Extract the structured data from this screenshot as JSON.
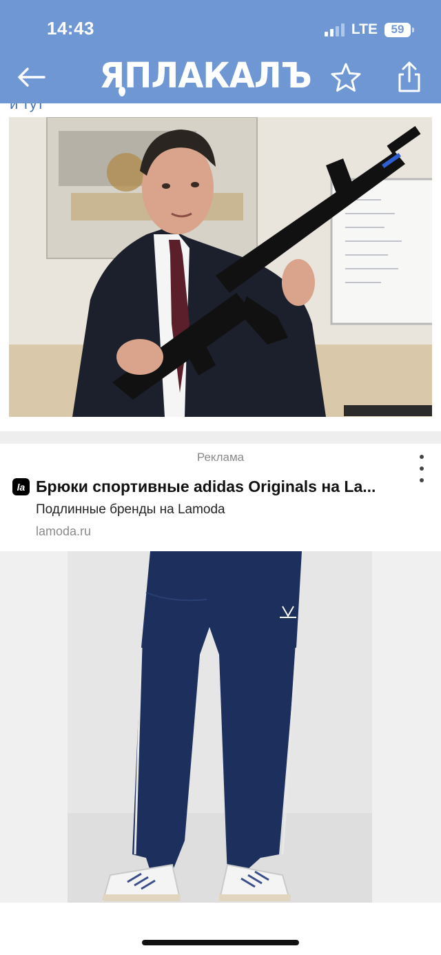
{
  "status_bar": {
    "time": "14:43",
    "network": "LTE",
    "battery": "59"
  },
  "header": {
    "logo_text": "ЯПЛАКАЛЪ"
  },
  "post": {
    "cut_text": "и тут"
  },
  "ad": {
    "label": "Реклама",
    "logo_text": "la",
    "title": "Брюки спортивные adidas Originals на La...",
    "subtitle": "Подлинные бренды на Lamoda",
    "domain": "lamoda.ru"
  },
  "colors": {
    "header_bg": "#6f97d4",
    "divider": "#eeeeee",
    "pants_navy": "#1d2f5c"
  }
}
